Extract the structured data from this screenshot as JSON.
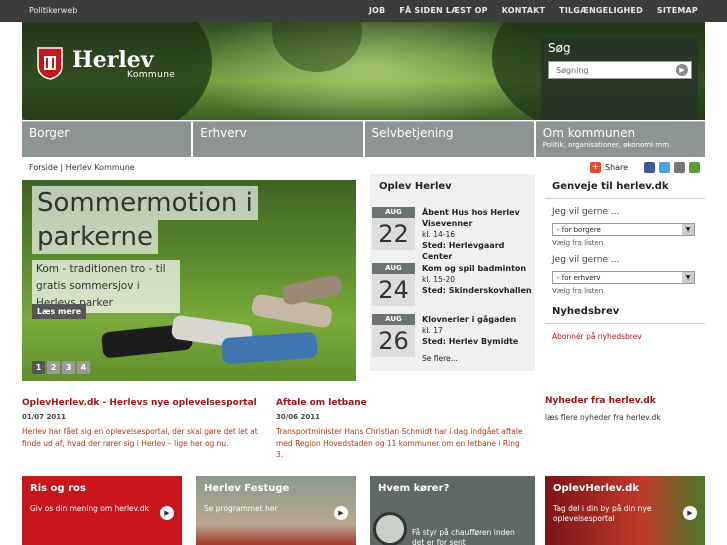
{
  "topbar": {
    "left": "Politikerweb",
    "links": [
      "JOB",
      "FÅ SIDEN LÆST OP",
      "KONTAKT",
      "TILGÆNGELIGHED",
      "SITEMAP"
    ]
  },
  "logo": {
    "name": "Herlev",
    "sub": "Kommune"
  },
  "search": {
    "title": "Søg",
    "placeholder": "Søgning"
  },
  "nav": [
    {
      "label": "Borger",
      "sub": ""
    },
    {
      "label": "Erhverv",
      "sub": ""
    },
    {
      "label": "Selvbetjening",
      "sub": ""
    },
    {
      "label": "Om kommunen",
      "sub": "Politik, organisationer, økonomi mm."
    }
  ],
  "breadcrumb": "Forside | Herlev Kommune",
  "share": {
    "label": "Share"
  },
  "slider": {
    "title1": "Sommermotion i",
    "title2": "parkerne",
    "kicker": "Kom - traditionen tro - til gratis sommersjov i Herlevs parker",
    "more": "Læs mere",
    "pages": [
      "1",
      "2",
      "3",
      "4"
    ]
  },
  "events": {
    "header": "Oplev Herlev",
    "see_more": "Se flere...",
    "items": [
      {
        "month": "AUG",
        "day": "22",
        "title": "Åbent Hus hos Herlev Visevenner",
        "time": "kl. 14-16",
        "place": "Sted: Herlevgaard Center"
      },
      {
        "month": "AUG",
        "day": "24",
        "title": "Kom og spil badminton",
        "time": "kl. 15-20",
        "place": "Sted: Skinderskovhallen"
      },
      {
        "month": "AUG",
        "day": "26",
        "title": "Klovnerier i gågaden",
        "time": "kl. 17",
        "place": "Sted: Herlev Bymidte"
      }
    ]
  },
  "shortcuts": {
    "header": "Genveje til herlev.dk",
    "label1": "Jeg vil gerne ...",
    "select1": "- for borgere",
    "hint1": "Vælg fra listen",
    "label2": "Jeg vil gerne ...",
    "select2": "- for erhverv",
    "hint2": "Vælg fra listen"
  },
  "newsletter": {
    "header": "Nyhedsbrev",
    "link": "Abonnér på nyhedsbrev"
  },
  "news": [
    {
      "title": "OplevHerlev.dk - Herlevs nye oplevelsesportal",
      "date": "01/07 2011",
      "body": "Herlev har fået sig en oplevelsesportal, der skal gøre det let at finde ud af, hvad der rører sig i Herlev – lige her og nu."
    },
    {
      "title": "Aftale om letbane",
      "date": "30/06 2011",
      "body": "Transportminister Hans Christian Schmidt har i dag indgået aftale med Region Hovedstaden og 11 kommuner om en letbane i Ring 3."
    }
  ],
  "news_right": {
    "title": "Nyheder fra herlev.dk",
    "body": "læs flere nyheder fra herlev.dk"
  },
  "promos": [
    {
      "title": "Ris og ros",
      "body": "Giv os din mening om herlev.dk",
      "color": "#c8151b"
    },
    {
      "title": "Herlev Festuge",
      "body": "Se programmet her",
      "color": "#7a8a7c"
    },
    {
      "title": "Hvem kører?",
      "body": "Få styr på chaufføren inden det er for sent",
      "color": "#5e6a63"
    },
    {
      "title": "OplevHerlev.dk",
      "body": "Tag del i din by på din nye oplevelsesportal",
      "color": "#9b1c1c"
    }
  ]
}
